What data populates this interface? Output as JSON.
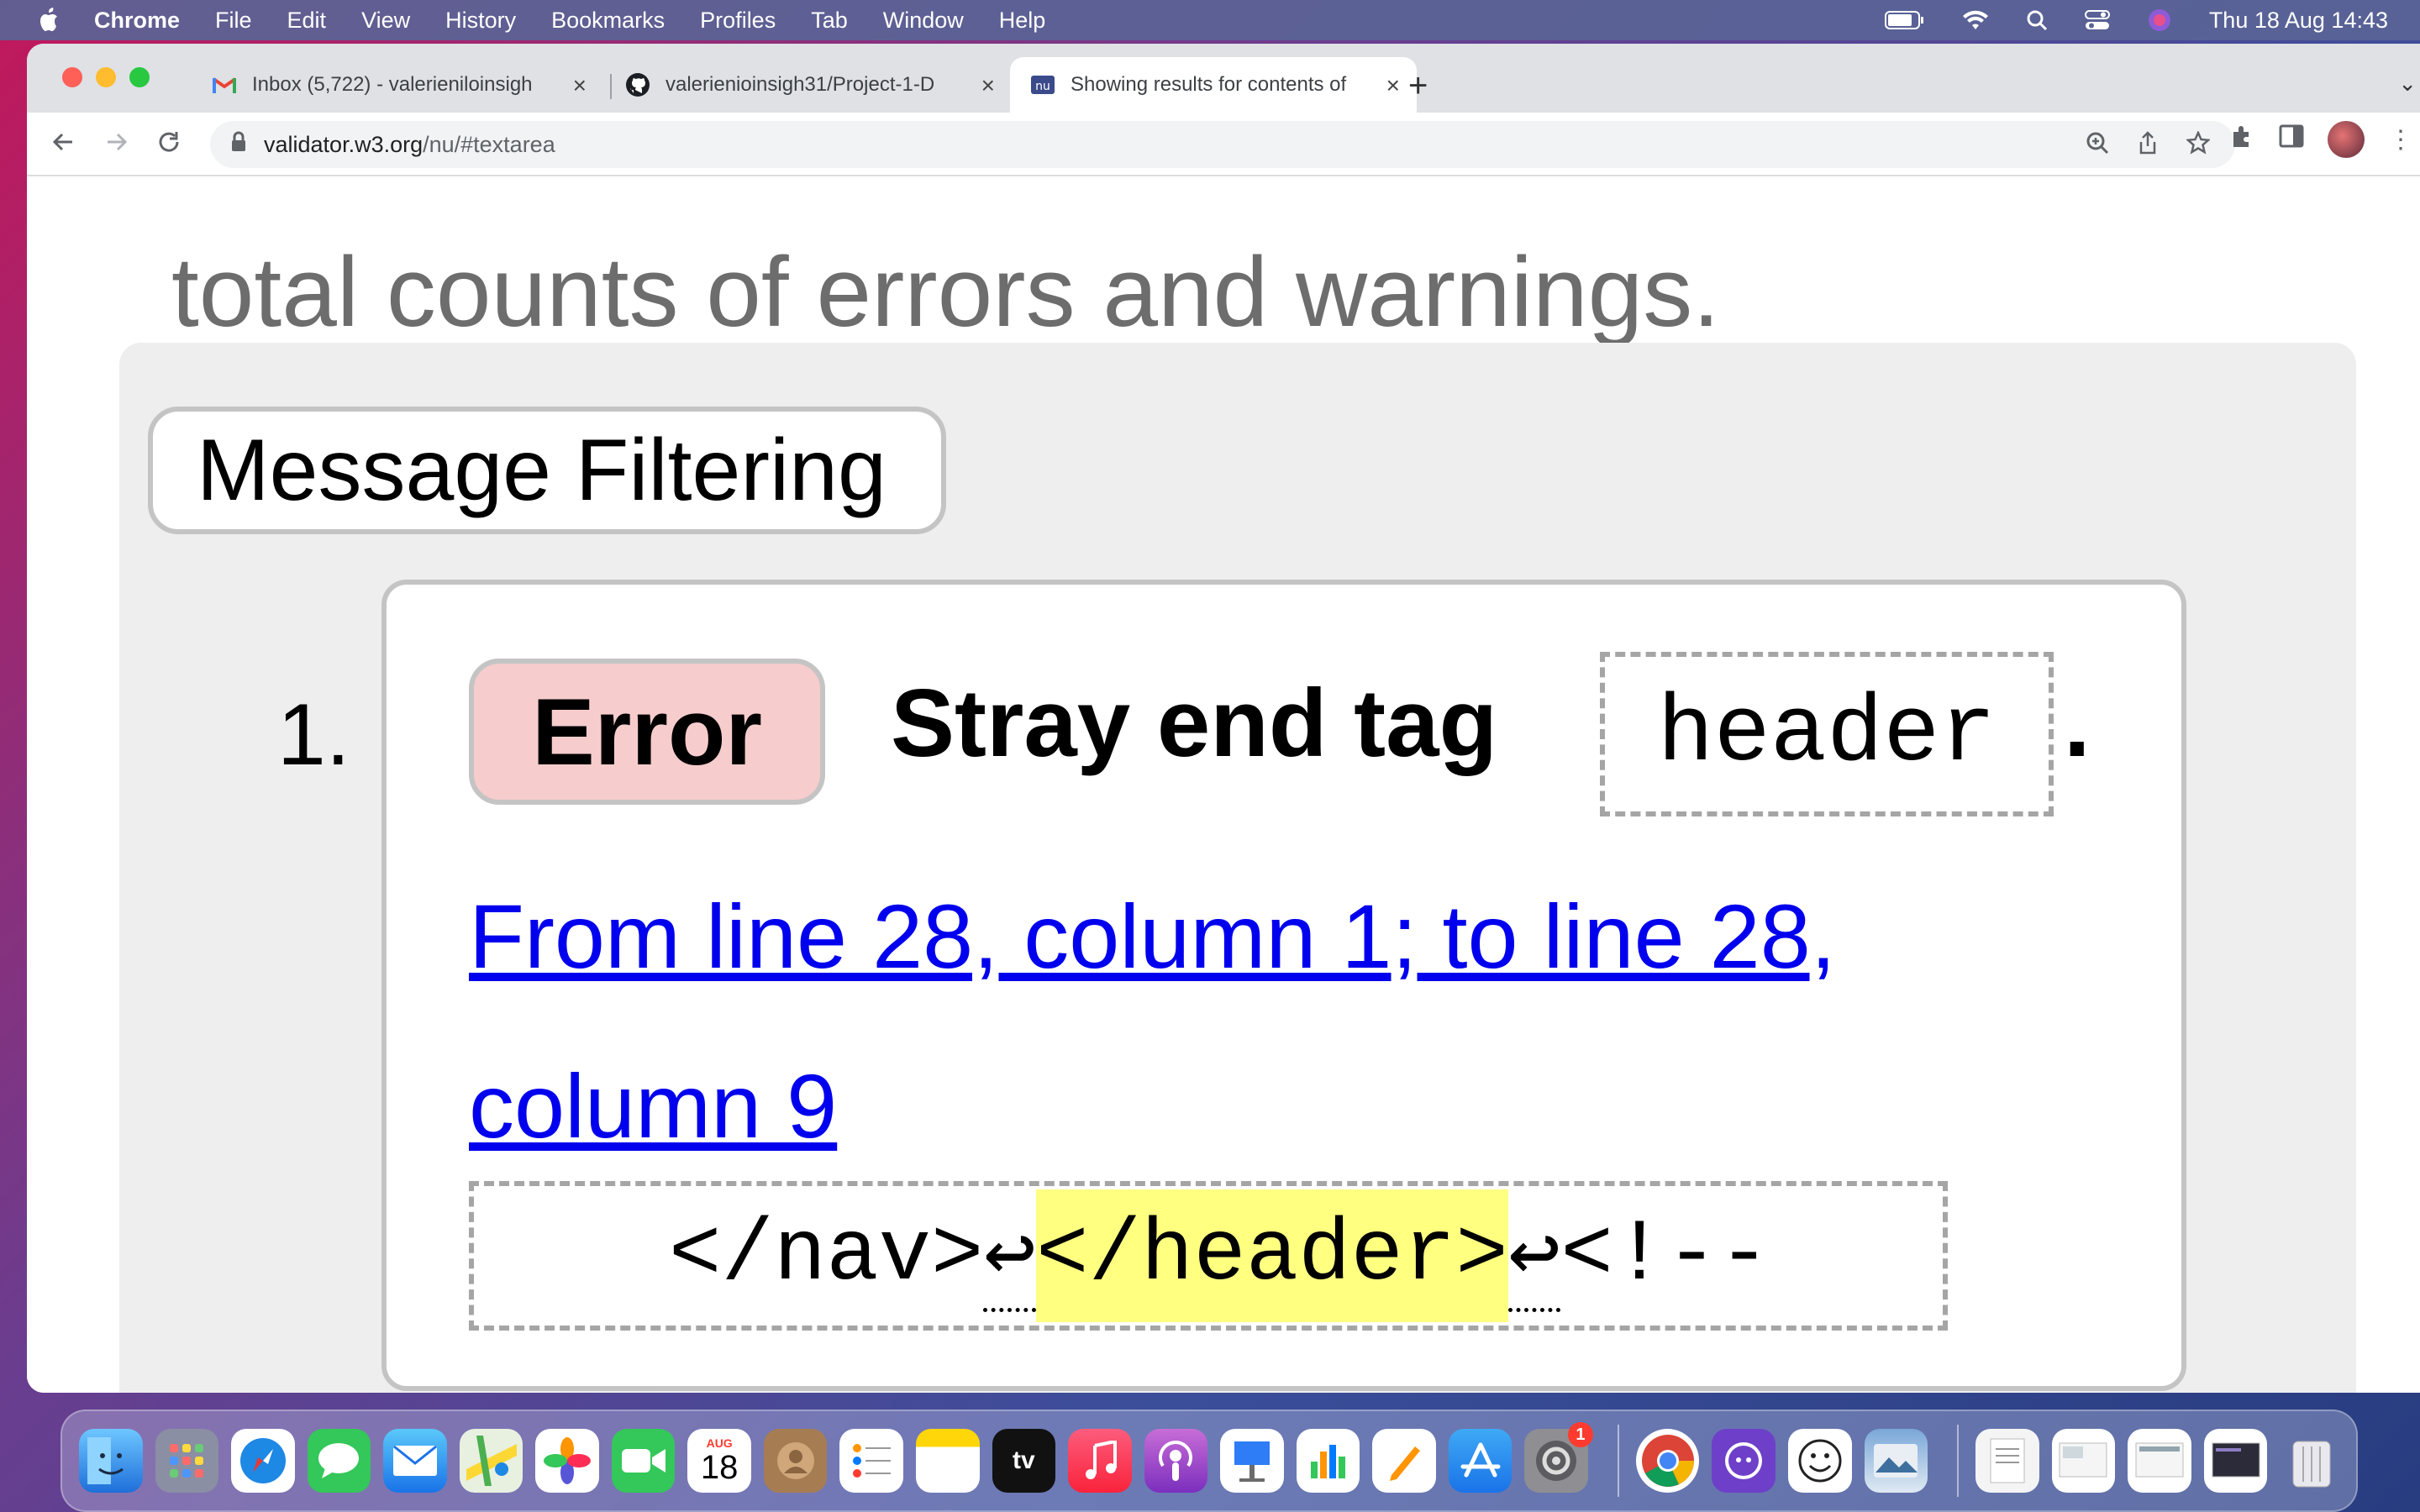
{
  "menubar": {
    "app": "Chrome",
    "items": [
      "File",
      "Edit",
      "View",
      "History",
      "Bookmarks",
      "Profiles",
      "Tab",
      "Window",
      "Help"
    ],
    "clock": "Thu 18 Aug  14:43"
  },
  "tabs": [
    {
      "title": "Inbox (5,722) - valerieniloinsigh",
      "icon": "gmail-icon"
    },
    {
      "title": "valerienioinsigh31/Project-1-D",
      "icon": "github-icon"
    },
    {
      "title": "Showing results for contents of",
      "icon": "w3c-validator-icon",
      "active": true
    }
  ],
  "toolbar": {
    "url_host": "validator.w3.org",
    "url_path": "/nu/#textarea"
  },
  "page": {
    "heading_fragment": "total counts of errors and warnings.",
    "legend": "Message Filtering",
    "message": {
      "number": "1.",
      "type": "Error",
      "text": "Stray end tag",
      "code": "header",
      "period": ".",
      "location": "From line 28, column 1; to line 28, column 9",
      "extract_before": "</nav>",
      "extract_lf1": "↩",
      "extract_highlight": "</header>",
      "extract_lf2": "↩",
      "extract_after": "<!--"
    }
  },
  "dock": {
    "calendar_month": "AUG",
    "calendar_day": "18",
    "tv_label": "tv",
    "settings_badge": "1"
  }
}
